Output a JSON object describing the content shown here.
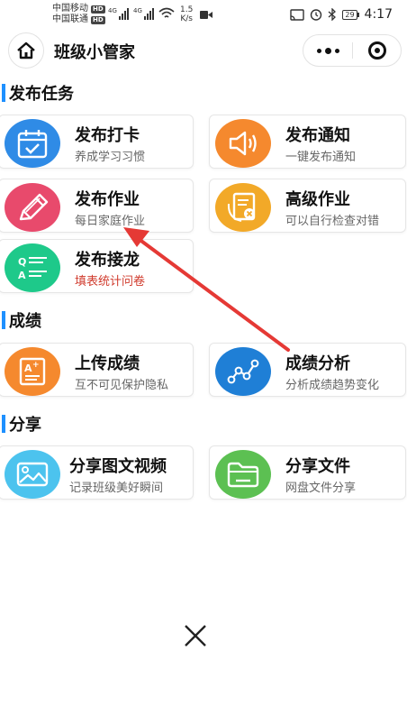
{
  "status_bar": {
    "carrier1": "中国移动",
    "carrier2": "中国联通",
    "hd_label": "HD",
    "net1": "4G",
    "net2": "4G",
    "speed_value": "1.5",
    "speed_unit": "K/s",
    "battery": "29",
    "time": "4:17"
  },
  "header": {
    "title": "班级小管家"
  },
  "sections": {
    "publish": {
      "title": "发布任务"
    },
    "grades": {
      "title": "成绩"
    },
    "share": {
      "title": "分享"
    }
  },
  "cards": {
    "checkin": {
      "title": "发布打卡",
      "subtitle": "养成学习习惯",
      "color": "#2f8be6"
    },
    "notice": {
      "title": "发布通知",
      "subtitle": "一键发布通知",
      "color": "#f5892e"
    },
    "homework": {
      "title": "发布作业",
      "subtitle": "每日家庭作业",
      "color": "#e84a6c"
    },
    "adv_homework": {
      "title": "高级作业",
      "subtitle": "可以自行检查对错",
      "color": "#f2a928"
    },
    "relay": {
      "title": "发布接龙",
      "subtitle": "填表统计问卷",
      "color": "#1ec98a"
    },
    "upload_grades": {
      "title": "上传成绩",
      "subtitle": "互不可见保护隐私",
      "color": "#f5892e"
    },
    "grade_analysis": {
      "title": "成绩分析",
      "subtitle": "分析成绩趋势变化",
      "color": "#1f7fd6"
    },
    "share_media": {
      "title": "分享图文视频",
      "subtitle": "记录班级美好瞬间",
      "color": "#4cc3ee"
    },
    "share_file": {
      "title": "分享文件",
      "subtitle": "网盘文件分享",
      "color": "#5cc052"
    }
  },
  "annotation_color": "#e53935"
}
